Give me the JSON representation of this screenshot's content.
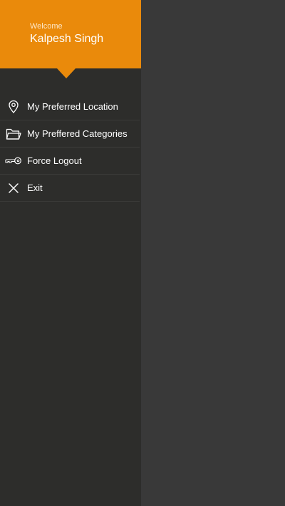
{
  "header": {
    "welcome_label": "Welcome",
    "user_name": "Kalpesh Singh"
  },
  "menu": {
    "items": [
      {
        "label": "My Preferred Location",
        "icon": "location-pin-icon"
      },
      {
        "label": "My Preffered Categories",
        "icon": "folder-icon"
      },
      {
        "label": "Force Logout",
        "icon": "key-icon"
      },
      {
        "label": "Exit",
        "icon": "close-icon"
      }
    ]
  },
  "colors": {
    "accent": "#ea8a0b",
    "drawer_background": "#2d2d2b",
    "content_background": "#393939",
    "text": "#ffffff"
  }
}
